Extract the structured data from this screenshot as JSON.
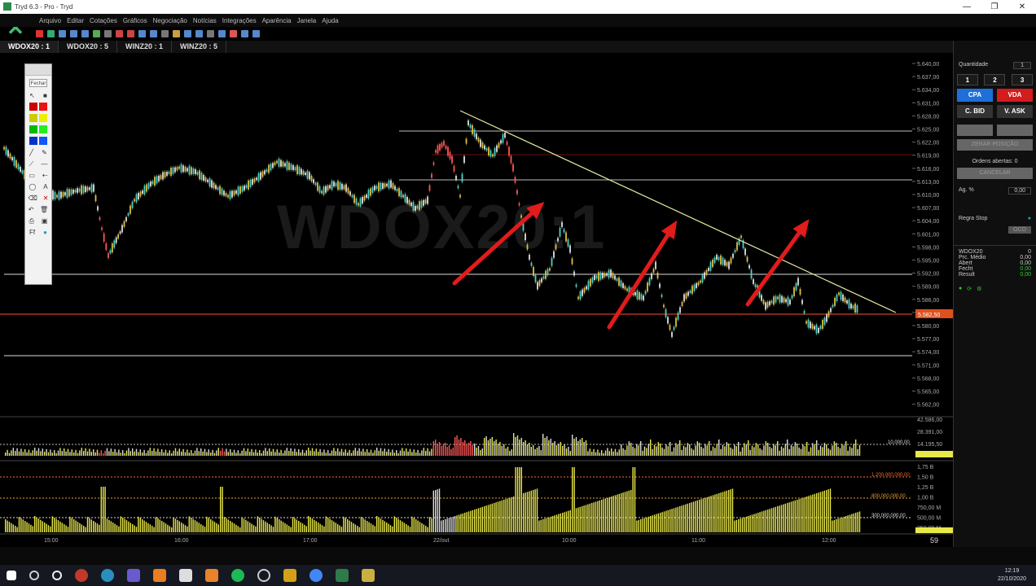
{
  "window": {
    "title": "Tryd 6.3 - Pro - Tryd",
    "controls": [
      "—",
      "❐",
      "✕"
    ]
  },
  "menu": [
    "Arquivo",
    "Editar",
    "Cotações",
    "Gráficos",
    "Negociação",
    "Notícias",
    "Integrações",
    "Aparência",
    "Janela",
    "Ajuda"
  ],
  "tabs": [
    {
      "label": "WDOX20 : 1",
      "active": true
    },
    {
      "label": "WDOX20 : 5",
      "active": false
    },
    {
      "label": "WINZ20 : 1",
      "active": false
    },
    {
      "label": "WINZ20 : 5",
      "active": false
    }
  ],
  "chart": {
    "watermark": "WDOX20:1",
    "price_ticks": [
      "5.640,00",
      "5.637,00",
      "5.634,00",
      "5.631,00",
      "5.628,00",
      "5.625,00",
      "5.622,00",
      "5.619,00",
      "5.616,00",
      "5.613,00",
      "5.610,00",
      "5.607,00",
      "5.604,00",
      "5.601,00",
      "5.598,00",
      "5.595,00",
      "5.592,00",
      "5.589,00",
      "5.586,00",
      "5.583,00",
      "5.580,00",
      "5.577,00",
      "5.574,00",
      "5.571,00",
      "5.568,00",
      "5.565,00",
      "5.562,00"
    ],
    "last_price": "5.582,50",
    "volume_ticks": [
      "42.586,00",
      "28.391,00",
      "14.195,50"
    ],
    "volume_ref": "10.000,00",
    "fin_ticks": [
      "1,75 B",
      "1,50 B",
      "1,25 B",
      "1,00 B",
      "750,00 M",
      "500,00 M",
      "250,00 M"
    ],
    "fin_refs": [
      "1.200.000.000,00",
      "800.000.000,00",
      "300.000.000,00"
    ],
    "time_labels": [
      "15:00",
      "16:00",
      "17:00",
      "22/out",
      "10:00",
      "11:00",
      "12:00"
    ],
    "scroll_value": "59"
  },
  "drawing_panel": {
    "title": "Fechar",
    "extra": "Fechar"
  },
  "order_panel": {
    "qty_label": "Quantidade",
    "qty_value": "1",
    "qty_buttons": [
      "1",
      "2",
      "3"
    ],
    "buy": "CPA",
    "sell": "VDA",
    "buy_bid": "C. BID",
    "sell_ask": "V. ASK",
    "zero_pos": "ZERAR POSIÇÃO",
    "open_orders": "Ordens abertas: 0",
    "cancel": "CANCELAR",
    "price_label": "Ag. %",
    "price_value": "0,00",
    "stop_rule": "Regra Stop",
    "oco": "OCO",
    "symbol": "WDOX20",
    "symbol_qty": "0",
    "stats": [
      {
        "label": "Prc. Médio",
        "value": "0,00"
      },
      {
        "label": "Abert",
        "value": "0,00"
      },
      {
        "label": "Fecht",
        "value": "0,00"
      },
      {
        "label": "Result",
        "value": "0,00"
      }
    ]
  },
  "clock": {
    "time": "12:19",
    "date": "22/10/2020"
  },
  "colors": {
    "up": "#4fd1c5",
    "down": "#ff5555",
    "neutral": "#e0e0e0",
    "volume": "#e8e84a",
    "trendline": "#e8e8a0",
    "arrow": "#e21b1b",
    "buy": "#1e6fd9",
    "sell": "#d41c1c"
  }
}
